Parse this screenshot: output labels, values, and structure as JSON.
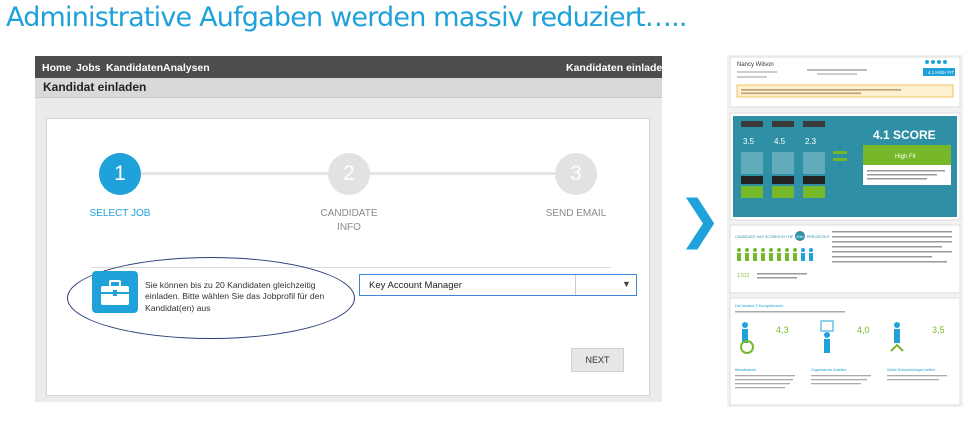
{
  "headline": "Administrative Aufgaben werden massiv reduziert…..",
  "nav": {
    "items": [
      "Home",
      "Jobs",
      "Kandidaten",
      "Analysen"
    ],
    "right": "Kandidaten einladen"
  },
  "subheader": {
    "title": "Kandidat einladen"
  },
  "steps": [
    {
      "number": "1",
      "label": "SELECT JOB",
      "active": true
    },
    {
      "number": "2",
      "label": "CANDIDATE INFO",
      "active": false
    },
    {
      "number": "3",
      "label": "SEND EMAIL",
      "active": false
    }
  ],
  "info_text": "Sie können bis zu 20 Kandidaten gleichzeitig einladen. Bitte wählen Sie das Jobprofil für den Kandidat(en) aus",
  "job_select": {
    "value": "Key Account Manager"
  },
  "next_button": "NEXT",
  "arrow": "❯",
  "report": {
    "candidate_name": "Nancy Wilson",
    "header_score": "4.1 HIGH FIT",
    "score_title": "4.1 SCORE",
    "score_badge": "High Fit",
    "factors": [
      {
        "title": "Total Score",
        "value": "3.5"
      },
      {
        "title": "Total Score",
        "value": "4.5"
      },
      {
        "title": "Total Score",
        "value": "2.3"
      }
    ],
    "factor_labels": [
      "PERSONALITY",
      "COGNITIVE ABILITY",
      "SITUATIONAL JUDGEMENT"
    ],
    "percentile_text": "CANDIDATE HAS SCORED IN THE",
    "percentile_badge": "80th",
    "percentile_suffix": "PERCENTILE",
    "candidate_count": "1,512",
    "competencies_title": "Die besten 3 Kompetenzen",
    "competencies": [
      {
        "value": "4,3",
        "name": "Belastbarkeit"
      },
      {
        "value": "4,0",
        "name": "Organisiertes Arbeiten"
      },
      {
        "value": "3,5",
        "name": "Solide Entscheidungen treffen"
      }
    ]
  },
  "colors": {
    "brand_blue": "#1fa1d9",
    "nav_dark": "#4d4d4d",
    "score_green": "#76b82a",
    "report_teal": "#2e8fa5"
  }
}
